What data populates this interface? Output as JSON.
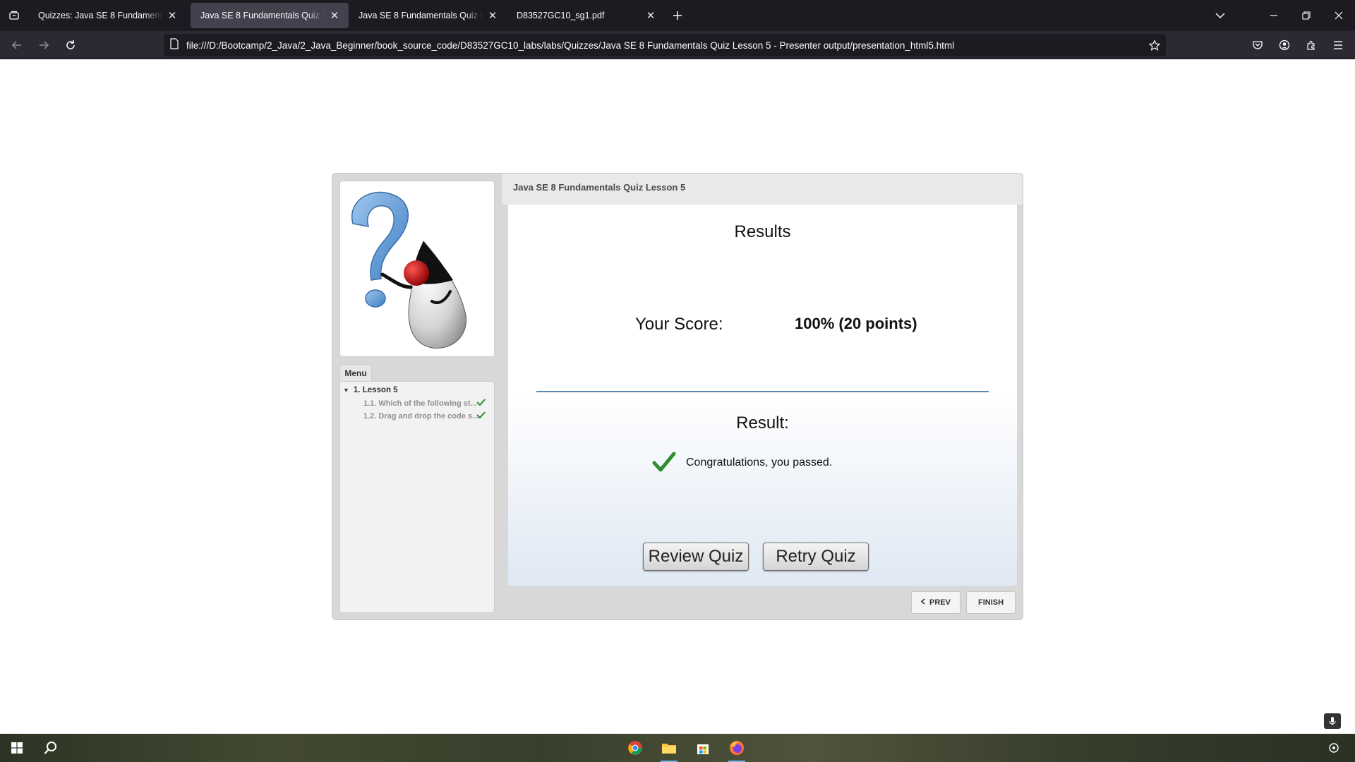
{
  "browser": {
    "tabs": [
      {
        "title": "Quizzes: Java SE 8 Fundamentals",
        "active": false
      },
      {
        "title": "Java SE 8 Fundamentals Quiz Lesson 5",
        "active": true
      },
      {
        "title": "Java SE 8 Fundamentals Quiz Lesson 5",
        "active": false
      },
      {
        "title": "D83527GC10_sg1.pdf",
        "active": false
      }
    ],
    "url": "file:///D:/Bootcamp/2_Java/2_Java_Beginner/book_source_code/D83527GC10_labs/labs/Quizzes/Java SE 8 Fundamentals Quiz Lesson 5 - Presenter output/presentation_html5.html"
  },
  "quiz": {
    "title": "Java SE 8 Fundamentals Quiz Lesson 5",
    "menu_tab": "Menu",
    "menu": {
      "section": "1. Lesson 5",
      "items": [
        {
          "label": "1.1. Which of the following st...",
          "completed": true
        },
        {
          "label": "1.2. Drag and drop the code s...",
          "completed": true
        }
      ]
    },
    "results_title": "Results",
    "score_label": "Your Score:",
    "score_value": "100% (20 points)",
    "result_label": "Result:",
    "result_message": "Congratulations, you passed.",
    "review_button": "Review Quiz",
    "retry_button": "Retry Quiz",
    "prev_button": "PREV",
    "finish_button": "FINISH"
  },
  "colors": {
    "pass_check": "#2e8b2e",
    "divider": "#5a86b5",
    "browser_dark": "#1c1b22"
  },
  "taskbar": {
    "icons": [
      "windows-start-icon",
      "search-icon",
      "chrome-icon",
      "file-explorer-icon",
      "store-icon",
      "firefox-icon"
    ]
  }
}
